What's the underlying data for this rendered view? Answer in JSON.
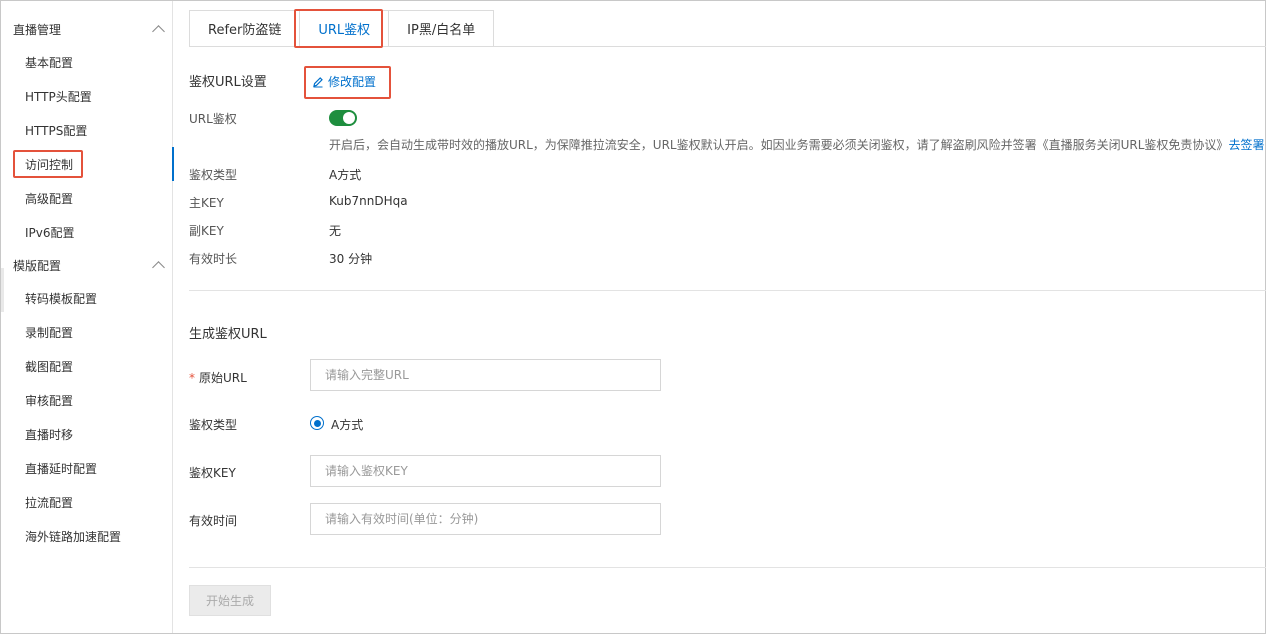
{
  "sidebar": {
    "group1": {
      "title": "直播管理"
    },
    "group1_items": [
      {
        "label": "基本配置"
      },
      {
        "label": "HTTP头配置"
      },
      {
        "label": "HTTPS配置"
      },
      {
        "label": "访问控制"
      },
      {
        "label": "高级配置"
      },
      {
        "label": "IPv6配置"
      }
    ],
    "group2": {
      "title": "模版配置"
    },
    "group2_items": [
      {
        "label": "转码模板配置"
      },
      {
        "label": "录制配置"
      },
      {
        "label": "截图配置"
      },
      {
        "label": "审核配置"
      },
      {
        "label": "直播时移"
      },
      {
        "label": "直播延时配置"
      },
      {
        "label": "拉流配置"
      },
      {
        "label": "海外链路加速配置"
      }
    ]
  },
  "tabs": [
    {
      "label": "Refer防盗链"
    },
    {
      "label": "URL鉴权"
    },
    {
      "label": "IP黑/白名单"
    }
  ],
  "auth_settings": {
    "title": "鉴权URL设置",
    "edit_label": "修改配置",
    "rows": [
      {
        "label": "URL鉴权"
      },
      {
        "label": "鉴权类型",
        "value": "A方式"
      },
      {
        "label": "主KEY",
        "value": "Kub7nnDHqa"
      },
      {
        "label": "副KEY",
        "value": "无"
      },
      {
        "label": "有效时长",
        "value": "30 分钟"
      }
    ],
    "note": "开启后，会自动生成带时效的播放URL，为保障推拉流安全，URL鉴权默认开启。如因业务需要必须关闭鉴权，请了解盗刷风险并签署《直播服务关闭URL鉴权免责协议》",
    "note_link": "去签署"
  },
  "generate": {
    "title": "生成鉴权URL",
    "origin_url": {
      "required_mark": "*",
      "label": "原始URL",
      "placeholder": "请输入完整URL"
    },
    "auth_type": {
      "label": "鉴权类型",
      "option": "A方式"
    },
    "auth_key": {
      "label": "鉴权KEY",
      "placeholder": "请输入鉴权KEY"
    },
    "valid_time": {
      "label": "有效时间",
      "placeholder": "请输入有效时间(单位：分钟)"
    },
    "submit_label": "开始生成"
  },
  "colors": {
    "accent": "#0070cc",
    "highlight": "#e4523b",
    "switch_on": "#1e8e3e"
  }
}
